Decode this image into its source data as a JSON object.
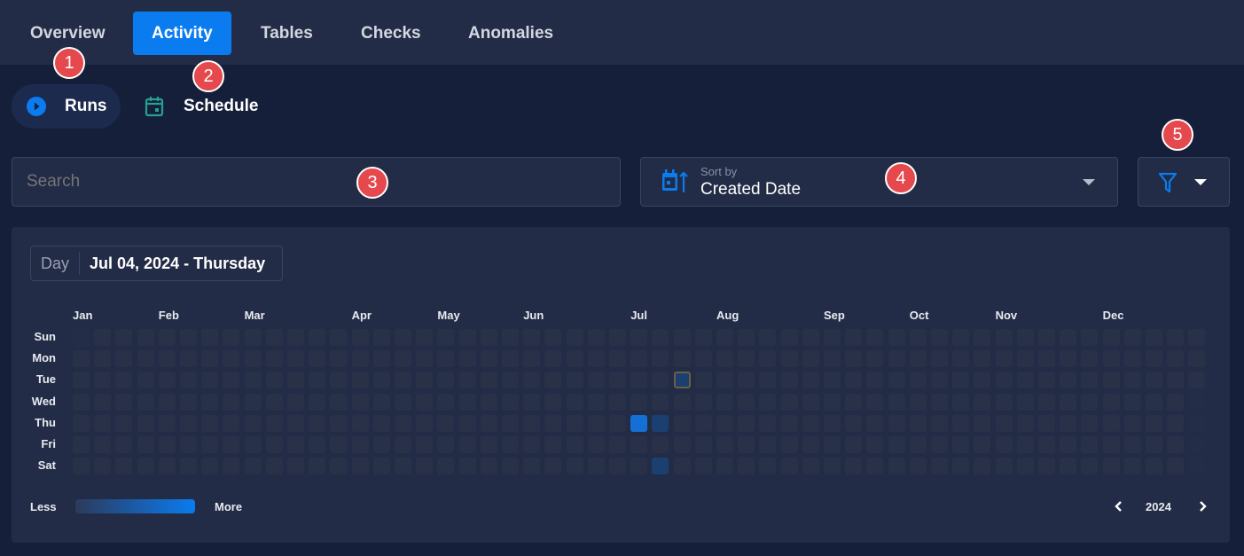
{
  "tabs": [
    {
      "label": "Overview",
      "active": false
    },
    {
      "label": "Activity",
      "active": true
    },
    {
      "label": "Tables",
      "active": false
    },
    {
      "label": "Checks",
      "active": false
    },
    {
      "label": "Anomalies",
      "active": false
    }
  ],
  "subtabs": [
    {
      "label": "Runs",
      "icon": "play-circle-icon",
      "active": true
    },
    {
      "label": "Schedule",
      "icon": "calendar-icon",
      "active": false
    }
  ],
  "search": {
    "placeholder": "Search",
    "value": ""
  },
  "sort": {
    "label": "Sort by",
    "value": "Created Date",
    "icon": "calendar-sort-icon"
  },
  "filter": {
    "icon": "filter-icon"
  },
  "annotations": [
    "1",
    "2",
    "3",
    "4",
    "5"
  ],
  "heatmap": {
    "mode_label": "Day",
    "selected_date": "Jul 04, 2024 - Thursday",
    "year": "2024",
    "months": [
      "Jan",
      "Feb",
      "Mar",
      "Apr",
      "May",
      "Jun",
      "Jul",
      "Aug",
      "Sep",
      "Oct",
      "Nov",
      "Dec"
    ],
    "weekdays": [
      "Sun",
      "Mon",
      "Tue",
      "Wed",
      "Thu",
      "Fri",
      "Sat"
    ],
    "legend_less": "Less",
    "legend_more": "More",
    "activity": [
      {
        "date": "2024-07-04",
        "level": 1.0,
        "selected": true
      },
      {
        "date": "2024-07-11",
        "level": 0.4
      },
      {
        "date": "2024-07-13",
        "level": 0.4
      },
      {
        "date": "2024-07-16",
        "level": 0.4,
        "today": true
      }
    ],
    "colors": {
      "empty": "#283148",
      "low": "#1b3f6f",
      "high": "#1570d6",
      "today_border": "#6b5e45",
      "accent": "#0a7cf0"
    }
  }
}
